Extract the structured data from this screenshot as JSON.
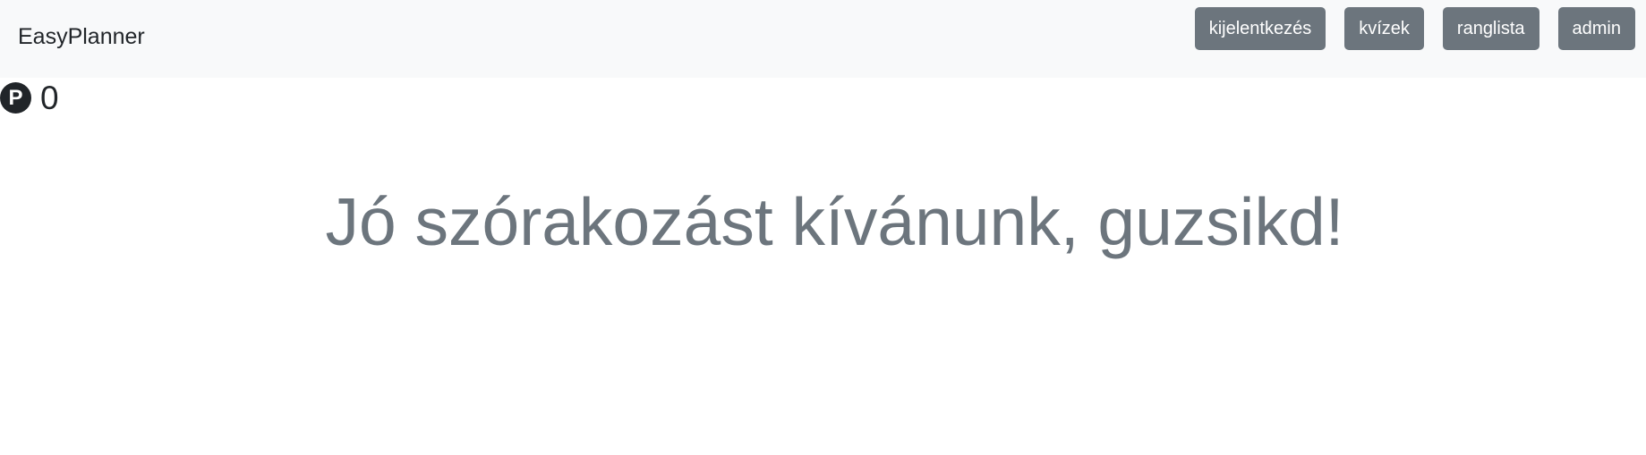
{
  "navbar": {
    "brand": "EasyPlanner",
    "buttons": [
      {
        "label": "kijelentkezés"
      },
      {
        "label": "kvízek"
      },
      {
        "label": "ranglista"
      },
      {
        "label": "admin"
      }
    ]
  },
  "points": {
    "icon_glyph": "P",
    "icon": "points-icon",
    "value": "0"
  },
  "main": {
    "welcome": "Jó szórakozást kívánunk, guzsikd!"
  },
  "colors": {
    "navbar_bg": "#f8f9fa",
    "button_bg": "#6c757d",
    "welcome_text": "#6c757d"
  }
}
